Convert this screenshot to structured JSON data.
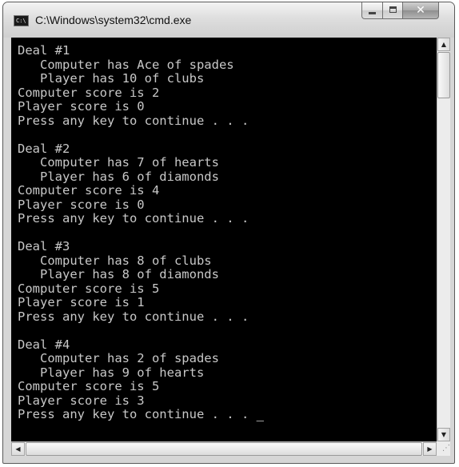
{
  "window": {
    "title": "C:\\Windows\\system32\\cmd.exe",
    "icon_text": "C:\\"
  },
  "console": {
    "lines": [
      "Deal #1",
      "   Computer has Ace of spades",
      "   Player has 10 of clubs",
      "Computer score is 2",
      "Player score is 0",
      "Press any key to continue . . .",
      "",
      "Deal #2",
      "   Computer has 7 of hearts",
      "   Player has 6 of diamonds",
      "Computer score is 4",
      "Player score is 0",
      "Press any key to continue . . .",
      "",
      "Deal #3",
      "   Computer has 8 of clubs",
      "   Player has 8 of diamonds",
      "Computer score is 5",
      "Player score is 1",
      "Press any key to continue . . .",
      "",
      "Deal #4",
      "   Computer has 2 of spades",
      "   Player has 9 of hearts",
      "Computer score is 5",
      "Player score is 3",
      "Press any key to continue . . ."
    ],
    "cursor": "_"
  },
  "icons": {
    "minimize": "minimize-icon",
    "maximize": "maximize-icon",
    "close": "close-icon",
    "scroll_up": "chevron-up-icon",
    "scroll_down": "chevron-down-icon",
    "scroll_left": "chevron-left-icon",
    "scroll_right": "chevron-right-icon",
    "resize_grip": "resize-grip-icon"
  },
  "glyphs": {
    "close": "✕",
    "up": "▲",
    "down": "▼",
    "left": "◀",
    "right": "▶",
    "grip": "⋰"
  },
  "colors": {
    "console_bg": "#000000",
    "console_fg": "#c8c8c8"
  }
}
